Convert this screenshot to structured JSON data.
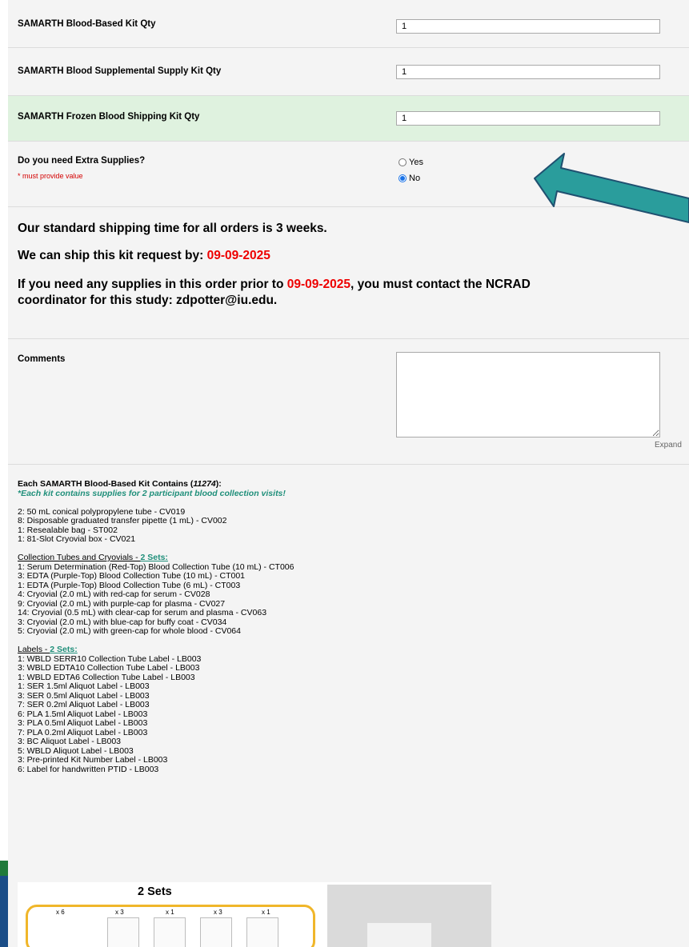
{
  "form": {
    "fields": [
      {
        "label": "SAMARTH Blood-Based Kit Qty",
        "value": "1"
      },
      {
        "label": "SAMARTH Blood Supplemental Supply Kit Qty",
        "value": "1"
      },
      {
        "label": "SAMARTH Frozen Blood Shipping Kit Qty",
        "value": "1"
      }
    ],
    "extra_supplies": {
      "label": "Do you need Extra Supplies?",
      "required_note": "* must provide value",
      "options": [
        "Yes",
        "No"
      ],
      "selected": "No"
    },
    "comments": {
      "label": "Comments",
      "expand_label": "Expand"
    }
  },
  "shipping": {
    "line1": "Our standard shipping time for all orders is 3 weeks.",
    "line2_prefix": "We can ship this kit request by: ",
    "date": "09-09-2025",
    "line3_prefix": "If you need any supplies in this order prior to ",
    "line3_suffix": ", you must contact the NCRAD",
    "line4": "coordinator for this study: zdpotter@iu.edu."
  },
  "kit_contents": {
    "title_prefix": "Each SAMARTH Blood-Based Kit Contains (",
    "kit_id": "11274",
    "title_suffix": "):",
    "subtitle": "*Each kit contains supplies for 2 participant blood collection visits!",
    "base_items": [
      "2: 50 mL conical polypropylene tube - CV019",
      "8: Disposable graduated transfer pipette (1 mL) - CV002",
      "1: Resealable bag - ST002",
      "1: 81-Slot Cryovial box - CV021"
    ],
    "collection_heading": "Collection Tubes and Cryovials - ",
    "collection_sets": "2 Sets:",
    "collection_items": [
      "1: Serum Determination (Red-Top) Blood Collection Tube (10 mL) - CT006",
      "3: EDTA (Purple-Top) Blood Collection Tube (10 mL) - CT001",
      "1: EDTA (Purple-Top) Blood Collection Tube (6 mL) - CT003",
      "4: Cryovial (2.0 mL) with red-cap for serum - CV028",
      "9: Cryovial (2.0 mL) with purple-cap for plasma - CV027",
      "14: Cryovial (0.5 mL) with clear-cap for serum and plasma - CV063",
      "3: Cryovial (2.0 mL) with blue-cap for buffy coat - CV034",
      "5: Cryovial (2.0 mL) with green-cap for whole blood - CV064"
    ],
    "labels_heading": "Labels - ",
    "labels_sets": "2 Sets:",
    "label_items": [
      "1: WBLD SERR10 Collection Tube Label - LB003",
      "3: WBLD EDTA10 Collection Tube Label - LB003",
      "1: WBLD EDTA6 Collection Tube Label - LB003",
      "1: SER 1.5ml Aliquot Label - LB003",
      "3: SER 0.5ml Aliquot Label - LB003",
      "7: SER 0.2ml Aliquot Label - LB003",
      "6: PLA 1.5ml Aliquot Label - LB003",
      "3: PLA 0.5ml Aliquot Label - LB003",
      "7: PLA 0.2ml Aliquot Label - LB003",
      "3: BC Aliquot Label - LB003",
      "5: WBLD Aliquot Label - LB003",
      "3: Pre-printed Kit Number Label - LB003",
      "6: Label for handwritten PTID - LB003"
    ]
  },
  "illustration": {
    "title": "2 Sets",
    "quantities": [
      "x 6",
      "x 3",
      "x 1",
      "x 3",
      "x 1"
    ]
  },
  "colors": {
    "date_red": "#ee0000",
    "teal": "#1f8f7a",
    "arrow": "#2a9d9c",
    "radio_blue": "#1a73e8"
  }
}
